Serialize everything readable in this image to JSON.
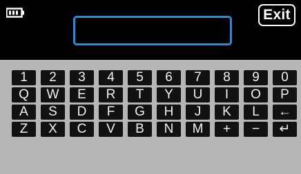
{
  "status": {
    "battery_icon": "battery-icon",
    "exit_label": "Exit"
  },
  "input": {
    "value": ""
  },
  "keyboard": {
    "rows": [
      [
        "1",
        "2",
        "3",
        "4",
        "5",
        "6",
        "7",
        "8",
        "9",
        "0"
      ],
      [
        "Q",
        "W",
        "E",
        "R",
        "T",
        "Y",
        "U",
        "I",
        "O",
        "P"
      ],
      [
        "A",
        "S",
        "D",
        "F",
        "G",
        "H",
        "J",
        "K",
        "L",
        "←"
      ],
      [
        "Z",
        "X",
        "C",
        "V",
        "B",
        "N",
        "M",
        "+",
        "−",
        "↵"
      ]
    ],
    "key_names": [
      [
        "key-1",
        "key-2",
        "key-3",
        "key-4",
        "key-5",
        "key-6",
        "key-7",
        "key-8",
        "key-9",
        "key-0"
      ],
      [
        "key-q",
        "key-w",
        "key-e",
        "key-r",
        "key-t",
        "key-y",
        "key-u",
        "key-i",
        "key-o",
        "key-p"
      ],
      [
        "key-a",
        "key-s",
        "key-d",
        "key-f",
        "key-g",
        "key-h",
        "key-j",
        "key-k",
        "key-l",
        "backspace-key"
      ],
      [
        "key-z",
        "key-x",
        "key-c",
        "key-v",
        "key-b",
        "key-n",
        "key-m",
        "plus-key",
        "minus-key",
        "enter-key"
      ]
    ]
  },
  "colors": {
    "input_border": "#1f8ee0",
    "key_bg": "#121212",
    "keyboard_bg": "#b6b6b6"
  }
}
